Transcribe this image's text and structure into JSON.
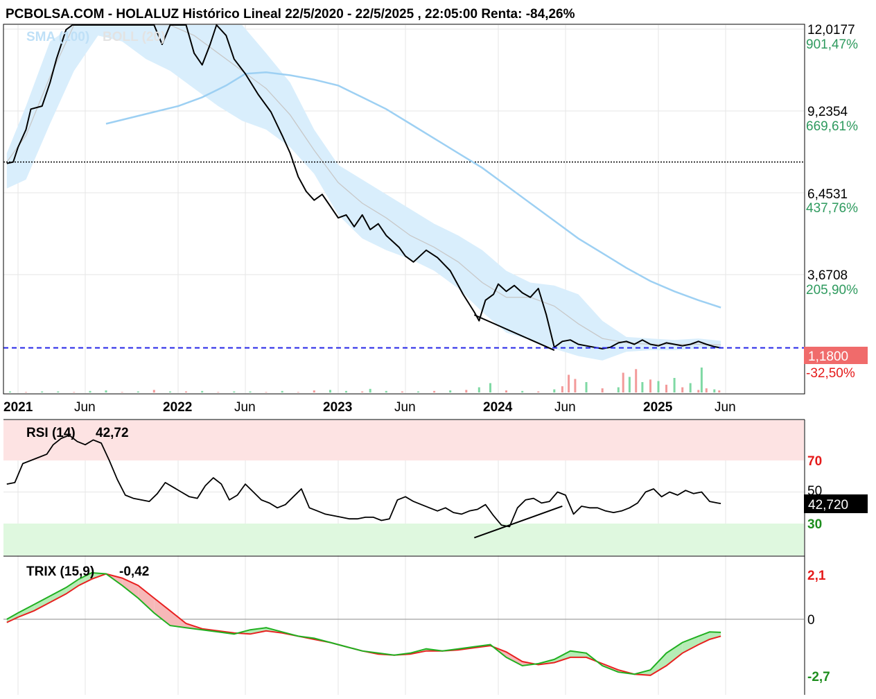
{
  "header": {
    "title": "PCBOLSA.COM - HOLALUZ Histórico Lineal 22/5/2020 - 22/5/2025 , 22:05:00 Renta: -84,26%"
  },
  "legend": {
    "sma_label": "SMA (100)",
    "boll_label": "BOLL (20)"
  },
  "price_axis": {
    "labels": [
      "12,0177",
      "9,2354",
      "6,4531",
      "3,6708"
    ],
    "percents": [
      "901,47%",
      "669,61%",
      "437,76%",
      "205,90%"
    ],
    "current_value": "1,1800",
    "current_percent": "-32,50%",
    "reference_level": 7.5
  },
  "x_axis": {
    "labels": [
      {
        "text": "2021",
        "bold": true,
        "date": 2021.0
      },
      {
        "text": "Jun",
        "bold": false,
        "date": 2021.42
      },
      {
        "text": "2022",
        "bold": true,
        "date": 2022.0
      },
      {
        "text": "Jun",
        "bold": false,
        "date": 2022.42
      },
      {
        "text": "2023",
        "bold": true,
        "date": 2023.0
      },
      {
        "text": "Jun",
        "bold": false,
        "date": 2023.42
      },
      {
        "text": "2024",
        "bold": true,
        "date": 2024.0
      },
      {
        "text": "Jun",
        "bold": false,
        "date": 2024.42
      },
      {
        "text": "2025",
        "bold": true,
        "date": 2025.0
      },
      {
        "text": "Jun",
        "bold": false,
        "date": 2025.42
      }
    ]
  },
  "rsi": {
    "label": "RSI (14)",
    "value_text": "42,72",
    "current_value": "42,720",
    "levels": [
      "70",
      "50",
      "30"
    ]
  },
  "trix": {
    "label": "TRIX (15,9)",
    "value_text": "-0,42",
    "levels": [
      "2,1",
      "0",
      "-2,7"
    ]
  },
  "colors": {
    "price_line": "#000000",
    "sma": "#9dd0f3",
    "boll_band": "#d9eefc",
    "boll_mid": "#c8c8c8",
    "last_price_line": "#2525e8",
    "last_price_badge": "#f06b6b",
    "negative_percent": "#e51a1a",
    "positive_percent": "#2e9a5e",
    "rsi_overbought": "#fde3e3",
    "rsi_oversold": "#dff8df",
    "trix_green": "#20b020",
    "trix_red": "#e82020",
    "volume_up": "#7fd9a4",
    "volume_down": "#f39a9a"
  },
  "chart_data": [
    {
      "type": "line",
      "name": "price",
      "x": [
        2020.93,
        2020.97,
        2021.0,
        2021.05,
        2021.08,
        2021.15,
        2021.2,
        2021.24,
        2021.27,
        2021.3,
        2021.34,
        2021.42,
        2021.5,
        2021.55,
        2021.62,
        2021.7,
        2021.78,
        2021.85,
        2021.9,
        2021.95,
        2022.0,
        2022.05,
        2022.1,
        2022.15,
        2022.2,
        2022.24,
        2022.3,
        2022.35,
        2022.42,
        2022.5,
        2022.58,
        2022.65,
        2022.7,
        2022.75,
        2022.8,
        2022.85,
        2022.9,
        2022.95,
        2023.0,
        2023.05,
        2023.1,
        2023.15,
        2023.2,
        2023.25,
        2023.3,
        2023.38,
        2023.42,
        2023.47,
        2023.55,
        2023.62,
        2023.7,
        2023.78,
        2023.85,
        2023.88,
        2023.92,
        2023.97,
        2024.0,
        2024.05,
        2024.1,
        2024.15,
        2024.2,
        2024.25,
        2024.3,
        2024.35,
        2024.4,
        2024.45,
        2024.5,
        2024.55,
        2024.6,
        2024.65,
        2024.7,
        2024.75,
        2024.8,
        2024.85,
        2024.9,
        2024.95,
        2025.0,
        2025.05,
        2025.1,
        2025.15,
        2025.2,
        2025.25,
        2025.3,
        2025.35,
        2025.39
      ],
      "y": [
        7.45,
        7.5,
        8.0,
        8.6,
        9.3,
        9.4,
        10.2,
        11.0,
        11.5,
        12.0,
        13.0,
        14.5,
        13.4,
        12.8,
        13.1,
        14.2,
        12.6,
        13.5,
        11.5,
        12.5,
        14.0,
        13.0,
        11.2,
        10.8,
        11.5,
        13.0,
        11.8,
        11.0,
        10.5,
        9.8,
        9.2,
        8.4,
        7.8,
        7.0,
        6.5,
        6.2,
        6.4,
        6.0,
        5.6,
        5.7,
        5.3,
        5.7,
        5.2,
        5.4,
        5.0,
        4.6,
        4.3,
        4.1,
        4.5,
        4.25,
        3.8,
        3.0,
        2.4,
        2.1,
        2.8,
        3.0,
        3.35,
        3.1,
        3.3,
        3.05,
        2.9,
        3.2,
        2.3,
        1.2,
        1.4,
        1.45,
        1.3,
        1.25,
        1.2,
        1.15,
        1.2,
        1.35,
        1.4,
        1.3,
        1.45,
        1.3,
        1.25,
        1.35,
        1.3,
        1.25,
        1.3,
        1.4,
        1.3,
        1.22,
        1.18
      ]
    },
    {
      "type": "line",
      "name": "SMA (100)",
      "x": [
        2021.55,
        2021.7,
        2021.85,
        2022.0,
        2022.15,
        2022.3,
        2022.42,
        2022.55,
        2022.7,
        2022.85,
        2023.0,
        2023.15,
        2023.3,
        2023.45,
        2023.6,
        2023.75,
        2023.9,
        2024.05,
        2024.2,
        2024.35,
        2024.5,
        2024.65,
        2024.8,
        2024.95,
        2025.1,
        2025.25,
        2025.39
      ],
      "y": [
        8.8,
        9.0,
        9.2,
        9.4,
        9.7,
        10.1,
        10.5,
        10.55,
        10.45,
        10.3,
        10.1,
        9.7,
        9.3,
        8.8,
        8.3,
        7.8,
        7.3,
        6.7,
        6.1,
        5.5,
        4.9,
        4.4,
        3.9,
        3.45,
        3.1,
        2.8,
        2.55
      ]
    },
    {
      "type": "area",
      "name": "BOLL (20)",
      "x": [
        2020.93,
        2021.05,
        2021.2,
        2021.35,
        2021.5,
        2021.65,
        2021.8,
        2021.95,
        2022.1,
        2022.25,
        2022.4,
        2022.55,
        2022.7,
        2022.85,
        2023.0,
        2023.15,
        2023.3,
        2023.45,
        2023.6,
        2023.75,
        2023.9,
        2024.05,
        2024.2,
        2024.35,
        2024.5,
        2024.65,
        2024.8,
        2024.95,
        2025.1,
        2025.25,
        2025.39
      ],
      "upper": [
        7.8,
        9.4,
        11.6,
        13.6,
        14.6,
        14.6,
        14.6,
        14.4,
        13.8,
        13.2,
        12.3,
        11.2,
        10.2,
        8.6,
        7.4,
        6.9,
        6.4,
        5.9,
        5.4,
        5.0,
        4.5,
        3.8,
        3.4,
        3.3,
        3.0,
        2.1,
        1.55,
        1.5,
        1.45,
        1.5,
        1.42
      ],
      "middle": [
        7.5,
        8.4,
        10.4,
        12.2,
        13.2,
        13.2,
        13.0,
        12.4,
        11.8,
        11.2,
        10.6,
        10.0,
        9.1,
        7.9,
        6.8,
        6.1,
        5.6,
        5.0,
        4.6,
        4.1,
        3.4,
        2.9,
        2.9,
        2.6,
        2.0,
        1.5,
        1.35,
        1.3,
        1.3,
        1.3,
        1.28
      ],
      "lower": [
        6.6,
        6.9,
        8.8,
        10.6,
        11.8,
        11.6,
        11.0,
        10.6,
        10.0,
        9.4,
        8.9,
        8.6,
        8.0,
        7.1,
        5.7,
        4.9,
        4.5,
        4.2,
        3.8,
        3.2,
        2.4,
        1.7,
        1.45,
        1.15,
        0.9,
        0.75,
        1.05,
        1.1,
        1.1,
        1.15,
        1.15
      ]
    },
    {
      "type": "line",
      "name": "RSI (14)",
      "ylim": [
        0,
        100
      ],
      "x": [
        2020.93,
        2020.98,
        2021.03,
        2021.08,
        2021.13,
        2021.18,
        2021.22,
        2021.27,
        2021.32,
        2021.37,
        2021.42,
        2021.47,
        2021.52,
        2021.57,
        2021.62,
        2021.67,
        2021.72,
        2021.77,
        2021.82,
        2021.87,
        2021.92,
        2021.97,
        2022.02,
        2022.07,
        2022.12,
        2022.17,
        2022.22,
        2022.27,
        2022.32,
        2022.37,
        2022.42,
        2022.47,
        2022.52,
        2022.57,
        2022.62,
        2022.67,
        2022.72,
        2022.77,
        2022.82,
        2022.87,
        2022.92,
        2022.97,
        2023.02,
        2023.07,
        2023.12,
        2023.17,
        2023.22,
        2023.27,
        2023.32,
        2023.37,
        2023.42,
        2023.47,
        2023.52,
        2023.57,
        2023.62,
        2023.67,
        2023.72,
        2023.77,
        2023.82,
        2023.87,
        2023.92,
        2023.97,
        2024.02,
        2024.07,
        2024.12,
        2024.17,
        2024.22,
        2024.27,
        2024.32,
        2024.37,
        2024.42,
        2024.47,
        2024.52,
        2024.57,
        2024.62,
        2024.67,
        2024.72,
        2024.77,
        2024.82,
        2024.87,
        2024.92,
        2024.97,
        2025.02,
        2025.07,
        2025.12,
        2025.17,
        2025.22,
        2025.27,
        2025.32,
        2025.37,
        2025.39
      ],
      "y": [
        55,
        56,
        68,
        70,
        72,
        74,
        80,
        84,
        86,
        82,
        80,
        83,
        81,
        70,
        58,
        48,
        46,
        45,
        44,
        49,
        56,
        53,
        50,
        47,
        46,
        54,
        59,
        55,
        45,
        48,
        55,
        50,
        45,
        43,
        40,
        42,
        47,
        52,
        40,
        38,
        36,
        35,
        34,
        33,
        33,
        34,
        34,
        32,
        33,
        45,
        47,
        44,
        42,
        40,
        38,
        40,
        37,
        36,
        38,
        39,
        42,
        35,
        29,
        28,
        40,
        45,
        46,
        43,
        44,
        50,
        48,
        36,
        41,
        40,
        40,
        38,
        37,
        38,
        40,
        43,
        50,
        52,
        47,
        50,
        48,
        51,
        49,
        50,
        44,
        43,
        42.72
      ]
    },
    {
      "type": "line",
      "name": "TRIX (15,9)",
      "ylim": [
        -3.2,
        2.8
      ],
      "x": [
        2020.93,
        2021.0,
        2021.1,
        2021.2,
        2021.3,
        2021.38,
        2021.46,
        2021.55,
        2021.65,
        2021.75,
        2021.85,
        2021.95,
        2022.05,
        2022.15,
        2022.25,
        2022.35,
        2022.45,
        2022.55,
        2022.65,
        2022.75,
        2022.85,
        2022.95,
        2023.05,
        2023.15,
        2023.25,
        2023.35,
        2023.45,
        2023.55,
        2023.65,
        2023.75,
        2023.85,
        2023.95,
        2024.05,
        2024.15,
        2024.25,
        2024.35,
        2024.45,
        2024.55,
        2024.65,
        2024.75,
        2024.85,
        2024.95,
        2025.05,
        2025.15,
        2025.25,
        2025.32,
        2025.39
      ],
      "series": [
        {
          "name": "TRIX",
          "values": [
            0.0,
            0.3,
            0.7,
            1.1,
            1.5,
            1.9,
            2.2,
            2.15,
            1.6,
            1.0,
            0.3,
            -0.3,
            -0.4,
            -0.5,
            -0.6,
            -0.7,
            -0.5,
            -0.4,
            -0.6,
            -0.8,
            -0.9,
            -1.1,
            -1.3,
            -1.5,
            -1.6,
            -1.7,
            -1.6,
            -1.4,
            -1.5,
            -1.4,
            -1.3,
            -1.2,
            -1.8,
            -2.2,
            -2.1,
            -1.9,
            -1.5,
            -1.6,
            -2.2,
            -2.5,
            -2.6,
            -2.4,
            -1.6,
            -1.1,
            -0.8,
            -0.6,
            -0.62
          ]
        },
        {
          "name": "Signal",
          "values": [
            -0.15,
            0.1,
            0.4,
            0.8,
            1.2,
            1.6,
            1.9,
            2.15,
            1.95,
            1.6,
            1.0,
            0.4,
            -0.2,
            -0.45,
            -0.55,
            -0.65,
            -0.7,
            -0.55,
            -0.65,
            -0.8,
            -0.95,
            -1.1,
            -1.3,
            -1.5,
            -1.65,
            -1.7,
            -1.65,
            -1.5,
            -1.5,
            -1.45,
            -1.35,
            -1.25,
            -1.55,
            -2.0,
            -2.15,
            -2.05,
            -1.8,
            -1.8,
            -2.1,
            -2.4,
            -2.6,
            -2.65,
            -2.2,
            -1.6,
            -1.2,
            -0.95,
            -0.8
          ]
        }
      ]
    },
    {
      "type": "bar",
      "name": "volume",
      "x": [
        2020.95,
        2021.05,
        2021.15,
        2021.25,
        2021.35,
        2021.45,
        2021.55,
        2021.65,
        2021.75,
        2021.85,
        2021.95,
        2022.05,
        2022.15,
        2022.25,
        2022.35,
        2022.45,
        2022.55,
        2022.65,
        2022.75,
        2022.85,
        2022.95,
        2023.05,
        2023.15,
        2023.2,
        2023.3,
        2023.4,
        2023.5,
        2023.6,
        2023.7,
        2023.8,
        2023.88,
        2023.95,
        2024.05,
        2024.15,
        2024.25,
        2024.35,
        2024.4,
        2024.44,
        2024.48,
        2024.55,
        2024.65,
        2024.75,
        2024.78,
        2024.82,
        2024.86,
        2024.9,
        2024.95,
        2025.0,
        2025.05,
        2025.1,
        2025.15,
        2025.2,
        2025.25,
        2025.27,
        2025.3,
        2025.35,
        2025.38
      ],
      "values": [
        2,
        1,
        2,
        2,
        1,
        3,
        4,
        1,
        2,
        5,
        2,
        2,
        3,
        1,
        2,
        2,
        1,
        3,
        1,
        4,
        5,
        3,
        2,
        7,
        3,
        2,
        2,
        3,
        4,
        5,
        10,
        18,
        4,
        3,
        2,
        6,
        12,
        34,
        26,
        20,
        8,
        10,
        38,
        30,
        45,
        20,
        25,
        22,
        15,
        28,
        10,
        18,
        5,
        48,
        8,
        6,
        4
      ],
      "up": [
        true,
        false,
        true,
        true,
        false,
        true,
        true,
        false,
        true,
        false,
        true,
        false,
        true,
        false,
        true,
        true,
        false,
        true,
        false,
        false,
        true,
        true,
        false,
        true,
        true,
        false,
        true,
        false,
        true,
        false,
        true,
        true,
        false,
        true,
        false,
        true,
        false,
        false,
        false,
        true,
        false,
        true,
        false,
        true,
        false,
        true,
        false,
        true,
        false,
        true,
        false,
        true,
        false,
        true,
        false,
        true,
        false
      ]
    }
  ]
}
